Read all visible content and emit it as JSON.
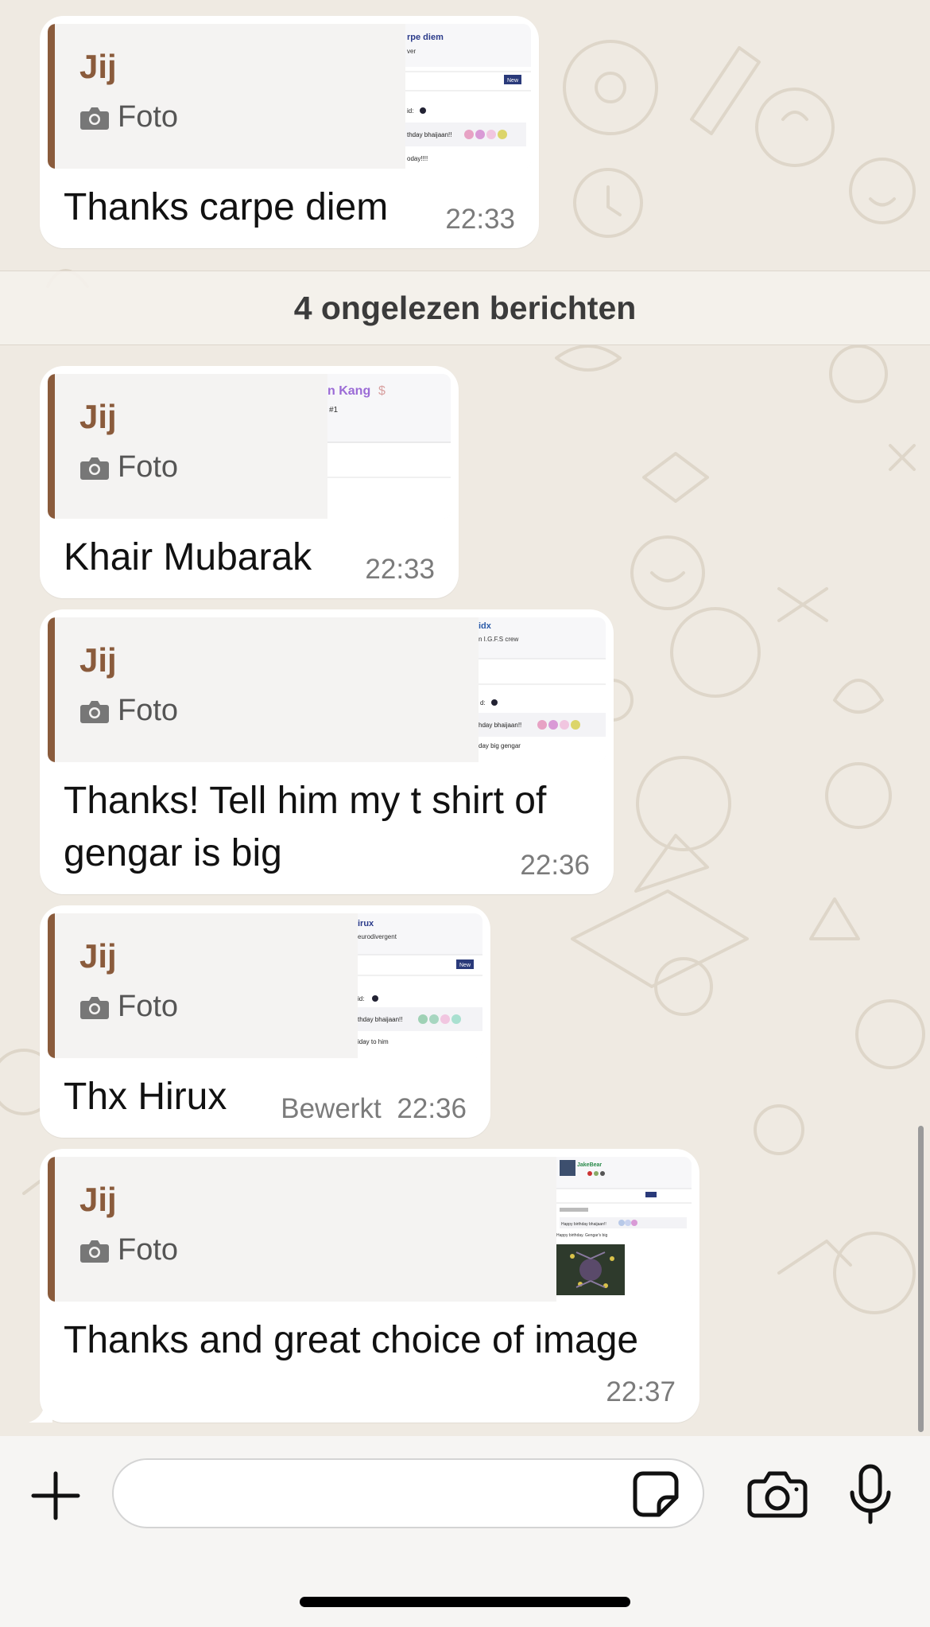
{
  "unread_banner": "4 ongelezen berichten",
  "messages": [
    {
      "quote_author": "Jij",
      "quote_type": "Foto",
      "text": "Thanks carpe diem",
      "time": "22:33",
      "edited": "",
      "thumb": {
        "name": "rpe diem",
        "sub": "ver",
        "btn": "New",
        "l1": "id:",
        "l2": "thday bhaijaan!!",
        "l3": "oday!!!!"
      }
    },
    {
      "quote_author": "Jij",
      "quote_type": "Foto",
      "text": "Khair Mubarak",
      "time": "22:33",
      "edited": "",
      "thumb": {
        "name": "n Kang",
        "sub": "#1"
      }
    },
    {
      "quote_author": "Jij",
      "quote_type": "Foto",
      "text": "Thanks! Tell him my t shirt of gengar is big",
      "time": "22:36",
      "edited": "",
      "thumb": {
        "name": "idx",
        "sub": "n I.G.F.S crew",
        "l1": "d:",
        "l2": "hday bhaijaan!!",
        "l3": "day big gengar"
      }
    },
    {
      "quote_author": "Jij",
      "quote_type": "Foto",
      "text": "Thx Hirux",
      "time": "22:36",
      "edited": "Bewerkt",
      "thumb": {
        "name": "irux",
        "sub": "eurodivergent",
        "btn": "New",
        "l1": "id:",
        "l2": "thday bhaijaan!!",
        "l3": "iday to him"
      }
    },
    {
      "quote_author": "Jij",
      "quote_type": "Foto",
      "text": "Thanks and great choice of image",
      "time": "22:37",
      "edited": "",
      "thumb": {
        "name": "JakeBear",
        "l2": "Happy birthday bhaijaan!!",
        "l3": "Happy birthday. Gengar's big"
      }
    }
  ],
  "composer": {
    "placeholder": ""
  },
  "icons": {
    "plus": "plus-icon",
    "sticker": "sticker-icon",
    "camera": "camera-icon",
    "mic": "microphone-icon"
  },
  "colors": {
    "chat_bg": "#efeae2",
    "bubble": "#ffffff",
    "quote_accent": "#8a5b3c",
    "time_text": "#7b7b7b"
  }
}
